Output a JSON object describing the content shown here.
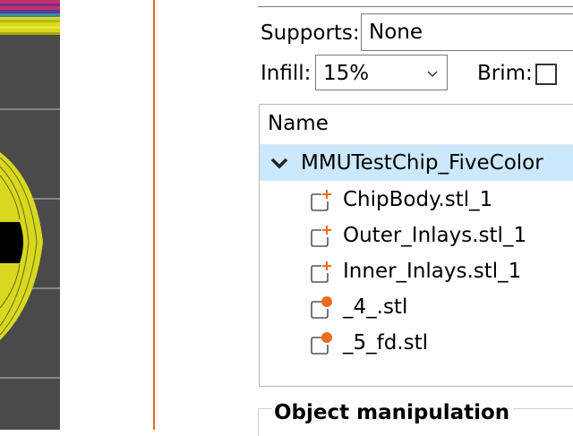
{
  "toolbar": {
    "supports_label": "Supports:",
    "supports_value": "None",
    "infill_label": "Infill:",
    "infill_value": "15%",
    "brim_label": "Brim:",
    "brim_checked": false
  },
  "object_list": {
    "column_header": "Name",
    "items": [
      {
        "label": "MMUTestChip_FiveColor",
        "icon": "chevron-down-icon",
        "selected": true,
        "level": 0
      },
      {
        "label": "ChipBody.stl_1",
        "icon": "part-plus-icon",
        "level": 1
      },
      {
        "label": "Outer_Inlays.stl_1",
        "icon": "part-plus-icon",
        "level": 1
      },
      {
        "label": "Inner_Inlays.stl_1",
        "icon": "part-plus-icon",
        "level": 1
      },
      {
        "label": "_4_.stl",
        "icon": "part-dot-icon",
        "level": 1
      },
      {
        "label": "_5_fd.stl",
        "icon": "part-dot-icon",
        "level": 1
      }
    ]
  },
  "section": {
    "title": "Object manipulation"
  },
  "colors": {
    "accent": "#ed6b21",
    "selection": "#cce8ff",
    "viewport_bg": "#4a4a4a",
    "model_yellow": "#d8d820"
  }
}
